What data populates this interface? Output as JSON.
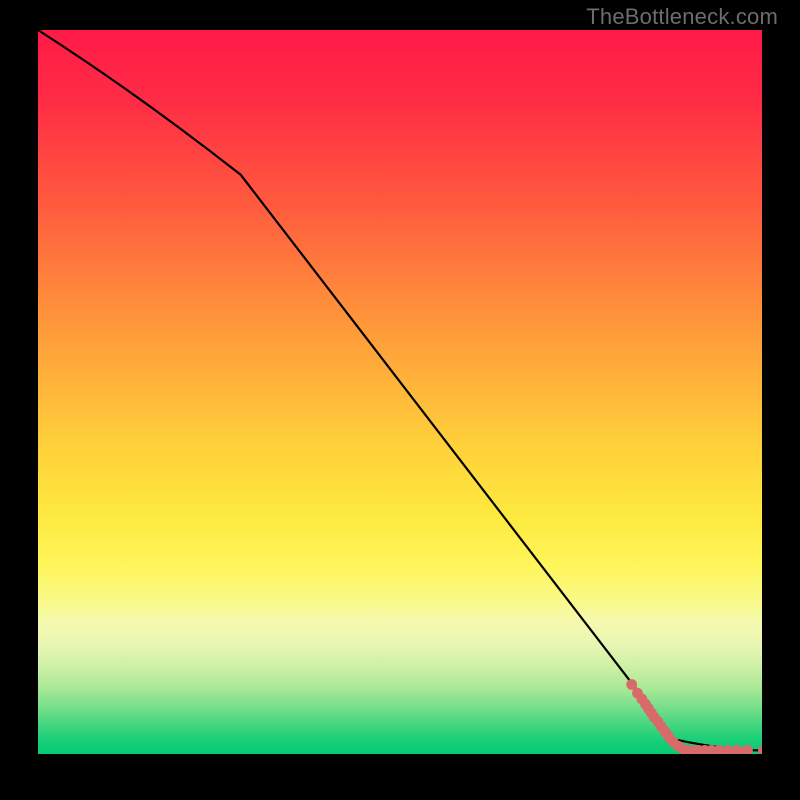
{
  "watermark": "TheBottleneck.com",
  "chart_data": {
    "type": "line",
    "title": "",
    "xlabel": "",
    "ylabel": "",
    "xlim": [
      0,
      100
    ],
    "ylim": [
      0,
      100
    ],
    "curve": [
      {
        "x": 0,
        "y": 100
      },
      {
        "x": 28,
        "y": 80
      },
      {
        "x": 88,
        "y": 2
      },
      {
        "x": 100,
        "y": 0.5
      }
    ],
    "series": [
      {
        "name": "points",
        "color": "#d96a6a",
        "values": [
          {
            "x": 82,
            "y": 9.6
          },
          {
            "x": 82.8,
            "y": 8.4
          },
          {
            "x": 83.4,
            "y": 7.6
          },
          {
            "x": 83.9,
            "y": 6.9
          },
          {
            "x": 84.3,
            "y": 6.3
          },
          {
            "x": 84.7,
            "y": 5.7
          },
          {
            "x": 85.1,
            "y": 5.1
          },
          {
            "x": 85.6,
            "y": 4.5
          },
          {
            "x": 86.1,
            "y": 3.8
          },
          {
            "x": 86.6,
            "y": 3.1
          },
          {
            "x": 87.1,
            "y": 2.4
          },
          {
            "x": 87.7,
            "y": 1.7
          },
          {
            "x": 88.4,
            "y": 1.1
          },
          {
            "x": 89.2,
            "y": 0.6
          },
          {
            "x": 90.3,
            "y": 0.5
          },
          {
            "x": 91.2,
            "y": 0.5
          },
          {
            "x": 92.1,
            "y": 0.5
          },
          {
            "x": 93.0,
            "y": 0.5
          },
          {
            "x": 94.1,
            "y": 0.5
          },
          {
            "x": 95.3,
            "y": 0.5
          },
          {
            "x": 96.6,
            "y": 0.5
          },
          {
            "x": 98.0,
            "y": 0.5
          },
          {
            "x": 100.2,
            "y": 0.5
          }
        ]
      }
    ],
    "background_gradient": {
      "top": "#ff1a47",
      "mid_upper": "#ff873b",
      "mid": "#fde93f",
      "mid_lower": "#e7f6b2",
      "bottom": "#05cb74"
    }
  }
}
